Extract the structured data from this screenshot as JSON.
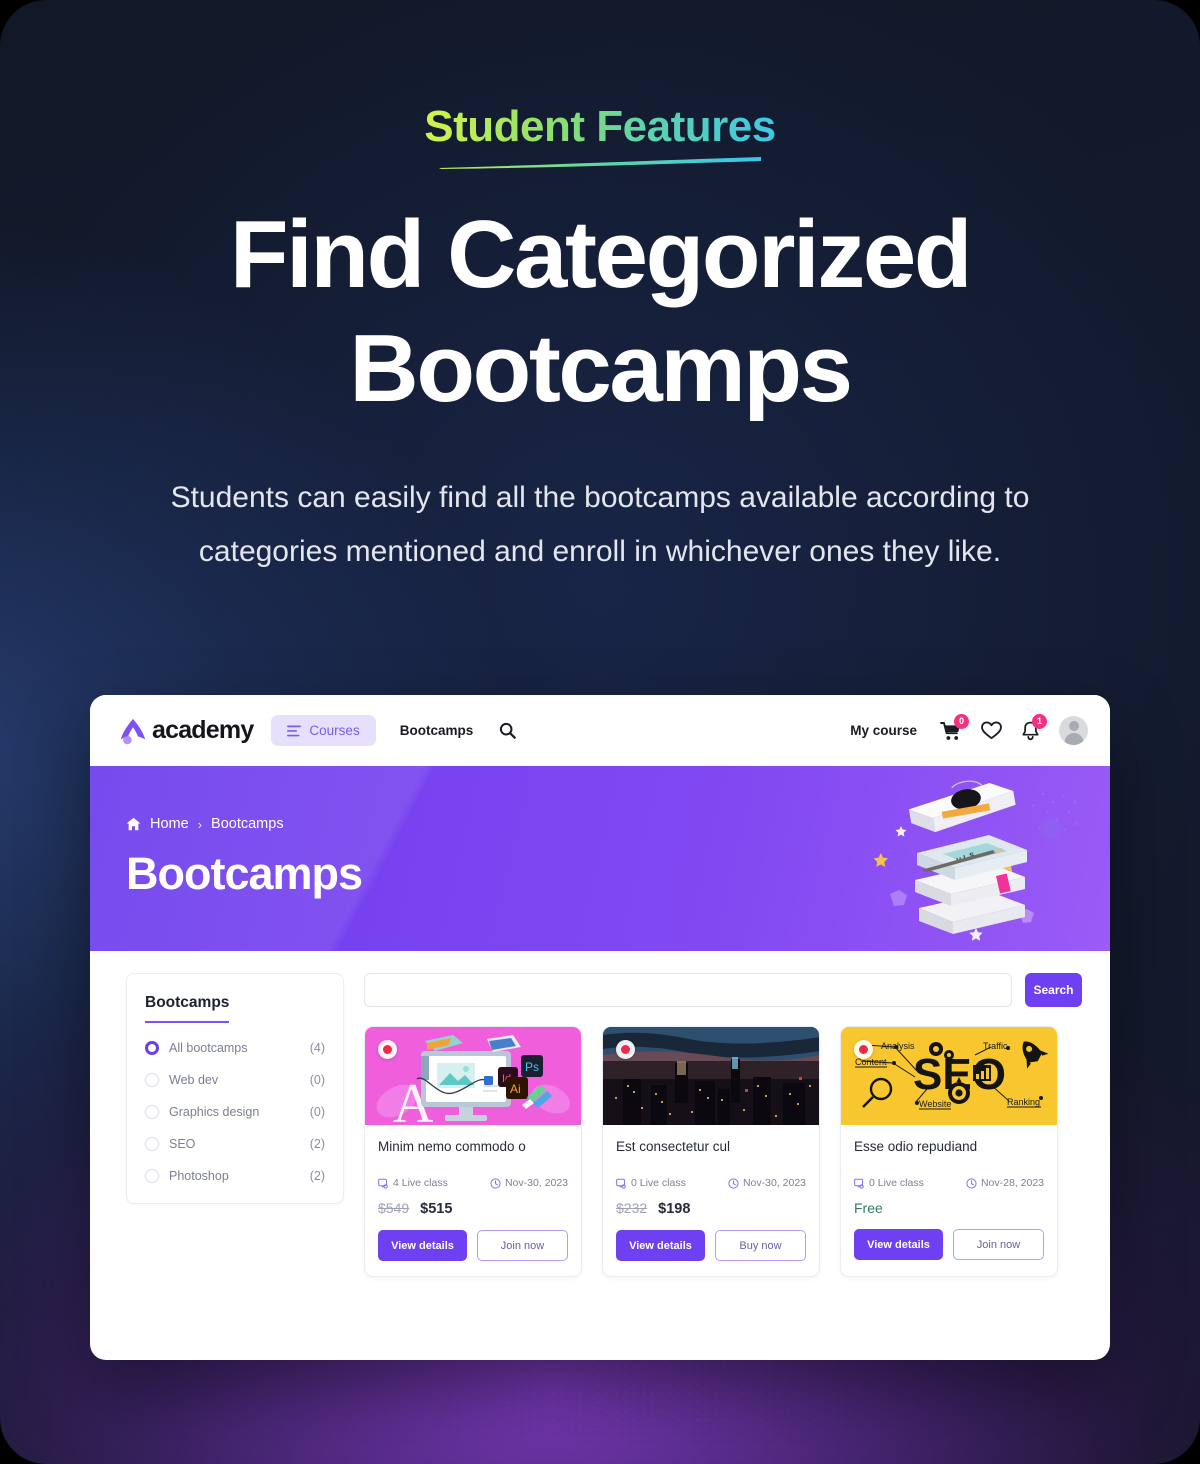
{
  "hero": {
    "eyebrow": "Student Features",
    "headline_line1": "Find Categorized",
    "headline_line2": "Bootcamps",
    "subcopy": "Students can easily find all the bootcamps available according to categories mentioned and enroll in whichever ones they like."
  },
  "app": {
    "navbar": {
      "brand": "academy",
      "courses_pill": "Courses",
      "bootcamps_link": "Bootcamps",
      "search_icon": "search-icon",
      "my_course": "My course",
      "cart_badge": "0",
      "bell_badge": "1"
    },
    "banner": {
      "home": "Home",
      "separator": "›",
      "current": "Bootcamps",
      "title": "Bootcamps"
    },
    "sidebar": {
      "title": "Bootcamps",
      "filters": [
        {
          "label": "All bootcamps",
          "count": "(4)",
          "selected": true
        },
        {
          "label": "Web dev",
          "count": "(0)",
          "selected": false
        },
        {
          "label": "Graphics design",
          "count": "(0)",
          "selected": false
        },
        {
          "label": "SEO",
          "count": "(2)",
          "selected": false
        },
        {
          "label": "Photoshop",
          "count": "(2)",
          "selected": false
        }
      ]
    },
    "search": {
      "value": "",
      "placeholder": "",
      "button": "Search"
    },
    "cards": [
      {
        "title": "Minim nemo commodo o",
        "live_class": "4 Live class",
        "date": "Nov-30, 2023",
        "old_price": "$549",
        "new_price": "$515",
        "free": "",
        "primary_button": "View details",
        "secondary_button": "Join now",
        "thumb_kind": "graphics-design"
      },
      {
        "title": "Est consectetur cul",
        "live_class": "0 Live class",
        "date": "Nov-30, 2023",
        "old_price": "$232",
        "new_price": "$198",
        "free": "",
        "primary_button": "View details",
        "secondary_button": "Buy now",
        "thumb_kind": "city-skyline"
      },
      {
        "title": "Esse odio repudiand",
        "live_class": "0 Live class",
        "date": "Nov-28, 2023",
        "old_price": "",
        "new_price": "",
        "free": "Free",
        "primary_button": "View details",
        "secondary_button": "Join now",
        "thumb_kind": "seo"
      }
    ],
    "seo_art": {
      "word": "SEO",
      "labels": [
        "Analysis",
        "Traffic",
        "Content",
        "Website",
        "Ranking"
      ]
    }
  },
  "colors": {
    "accent_purple": "#6e40f2",
    "banner_purple": "#7a44f0",
    "badge_pink": "#f4317f",
    "free_green": "#2f7d63",
    "page_bg": "#111827"
  }
}
